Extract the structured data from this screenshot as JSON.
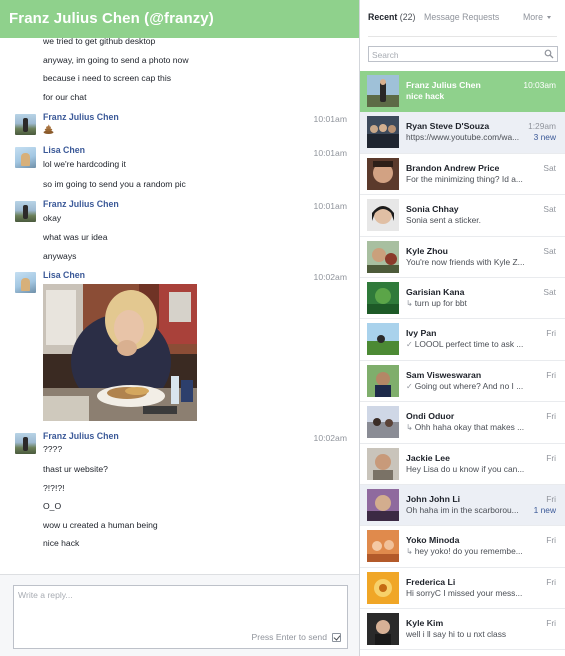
{
  "header": {
    "title": "Franz Julius Chen (@franzy)"
  },
  "conversation": {
    "lines": [
      {
        "text": "we tried to get github desktop"
      },
      {
        "text": "anyway, im going to send a photo now"
      },
      {
        "text": "because i need to screen cap this"
      },
      {
        "text": "for our chat"
      }
    ],
    "groups": [
      {
        "sender": "Franz Julius Chen",
        "time": "10:01am",
        "messages": []
      },
      {
        "sender": "Lisa Chen",
        "time": "10:01am",
        "messages": [
          "lol we're hardcoding it",
          "so im going to send you a random pic"
        ]
      },
      {
        "sender": "Franz Julius Chen",
        "time": "10:01am",
        "messages": [
          "okay",
          "what was ur idea",
          "anyways"
        ]
      },
      {
        "sender": "Lisa Chen",
        "time": "10:02am",
        "messages": []
      },
      {
        "sender": "Franz Julius Chen",
        "time": "10:02am",
        "messages": [
          "????",
          "thast ur website?",
          "?!?!?!",
          "O_O",
          "wow u created a human being",
          "nice hack"
        ]
      }
    ]
  },
  "composer": {
    "placeholder": "Write a reply...",
    "enter_label": "Press Enter to send"
  },
  "inbox": {
    "tab_recent": "Recent",
    "recent_count": "(22)",
    "tab_requests": "Message Requests",
    "tab_more": "More",
    "search_placeholder": "Search",
    "accent": "#8fd18c",
    "threads": [
      {
        "name": "Franz Julius Chen",
        "snippet": "nice hack",
        "time": "10:03am",
        "new": ""
      },
      {
        "name": "Ryan Steve D'Souza",
        "snippet": "https://www.youtube.com/wa...",
        "time": "1:29am",
        "new": "3 new"
      },
      {
        "name": "Brandon Andrew Price",
        "snippet": "For the minimizing thing? Id a...",
        "time": "Sat",
        "new": ""
      },
      {
        "name": "Sonia Chhay",
        "snippet": "Sonia sent a sticker.",
        "time": "Sat",
        "new": ""
      },
      {
        "name": "Kyle Zhou",
        "snippet": "You're now friends with Kyle Z...",
        "time": "Sat",
        "new": ""
      },
      {
        "name": "Garisian Kana",
        "snippet": "turn up for bbt",
        "time": "Sat",
        "new": ""
      },
      {
        "name": "Ivy Pan",
        "snippet": "LOOOL perfect time to ask ...",
        "time": "Fri",
        "new": ""
      },
      {
        "name": "Sam Visweswaran",
        "snippet": "Going out where? And no I ...",
        "time": "Fri",
        "new": ""
      },
      {
        "name": "Ondi Oduor",
        "snippet": "Ohh haha okay that makes ...",
        "time": "Fri",
        "new": ""
      },
      {
        "name": "Jackie Lee",
        "snippet": "Hey Lisa do u know if you can...",
        "time": "Fri",
        "new": ""
      },
      {
        "name": "John John Li",
        "snippet": "Oh haha im in the scarborou...",
        "time": "Fri",
        "new": "1 new"
      },
      {
        "name": "Yoko Minoda",
        "snippet": "hey yoko! do you remembe...",
        "time": "Fri",
        "new": ""
      },
      {
        "name": "Frederica Li",
        "snippet": "Hi sorryC I missed your mess...",
        "time": "Fri",
        "new": ""
      },
      {
        "name": "Kyle Kim",
        "snippet": "well i ll say hi to u nxt class",
        "time": "Fri",
        "new": ""
      }
    ]
  }
}
